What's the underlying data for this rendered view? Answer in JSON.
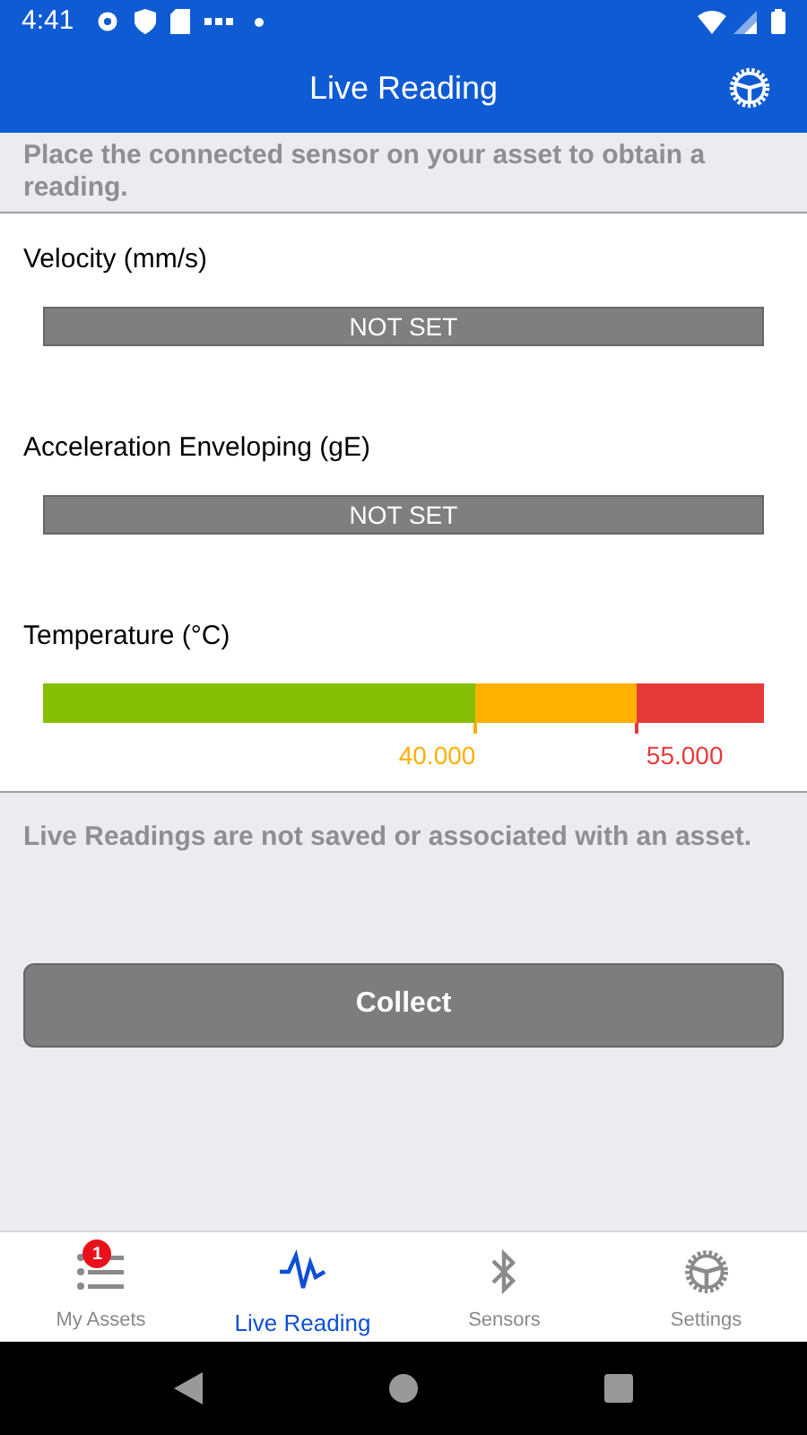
{
  "status_bar": {
    "time": "4:41"
  },
  "app_bar": {
    "title": "Live Reading"
  },
  "instruction": "Place the connected sensor on your asset to obtain a reading.",
  "readings": [
    {
      "kind": "unset",
      "label": "Velocity (mm/s)",
      "value": "NOT SET"
    },
    {
      "kind": "unset",
      "label": "Acceleration Enveloping (gE)",
      "value": "NOT SET"
    },
    {
      "kind": "gauge",
      "label": "Temperature (°C)",
      "thresholds": [
        {
          "label": "40.000",
          "color": "#ffb000"
        },
        {
          "label": "55.000",
          "color": "#e53a3a"
        }
      ]
    }
  ],
  "note": "Live Readings are not saved or associated with an asset.",
  "collect_button": "Collect",
  "bottom_nav": [
    {
      "label": "My Assets",
      "selected": false,
      "badge": "1"
    },
    {
      "label": "Live Reading",
      "selected": true
    },
    {
      "label": "Sensors",
      "selected": false
    },
    {
      "label": "Settings",
      "selected": false
    }
  ]
}
